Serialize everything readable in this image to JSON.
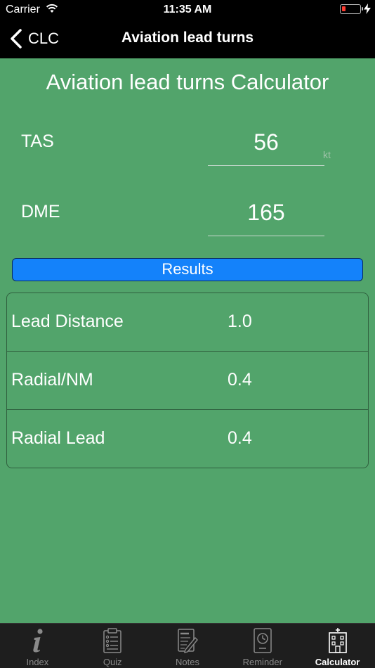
{
  "status": {
    "carrier": "Carrier",
    "time": "11:35 AM",
    "battery_level": 0.15,
    "charging": true
  },
  "nav": {
    "back_label": "CLC",
    "title": "Aviation lead turns"
  },
  "calculator": {
    "title": "Aviation lead turns Calculator",
    "fields": [
      {
        "label": "TAS",
        "value": "56",
        "unit": "kt"
      },
      {
        "label": "DME",
        "value": "165"
      }
    ],
    "results_button": "Results",
    "results": [
      {
        "label": "Lead Distance",
        "value": "1.0"
      },
      {
        "label": "Radial/NM",
        "value": "0.4"
      },
      {
        "label": "Radial Lead",
        "value": "0.4"
      }
    ]
  },
  "tabs": [
    {
      "label": "Index",
      "icon": "info-icon",
      "active": false
    },
    {
      "label": "Quiz",
      "icon": "clipboard-list-icon",
      "active": false
    },
    {
      "label": "Notes",
      "icon": "notes-icon",
      "active": false
    },
    {
      "label": "Reminder",
      "icon": "clock-icon",
      "active": false
    },
    {
      "label": "Calculator",
      "icon": "hospital-building-icon",
      "active": true
    }
  ],
  "colors": {
    "background": "#52a46b",
    "button": "#1482fa",
    "bar": "#000000",
    "tab_bar": "#1e1e1e"
  }
}
